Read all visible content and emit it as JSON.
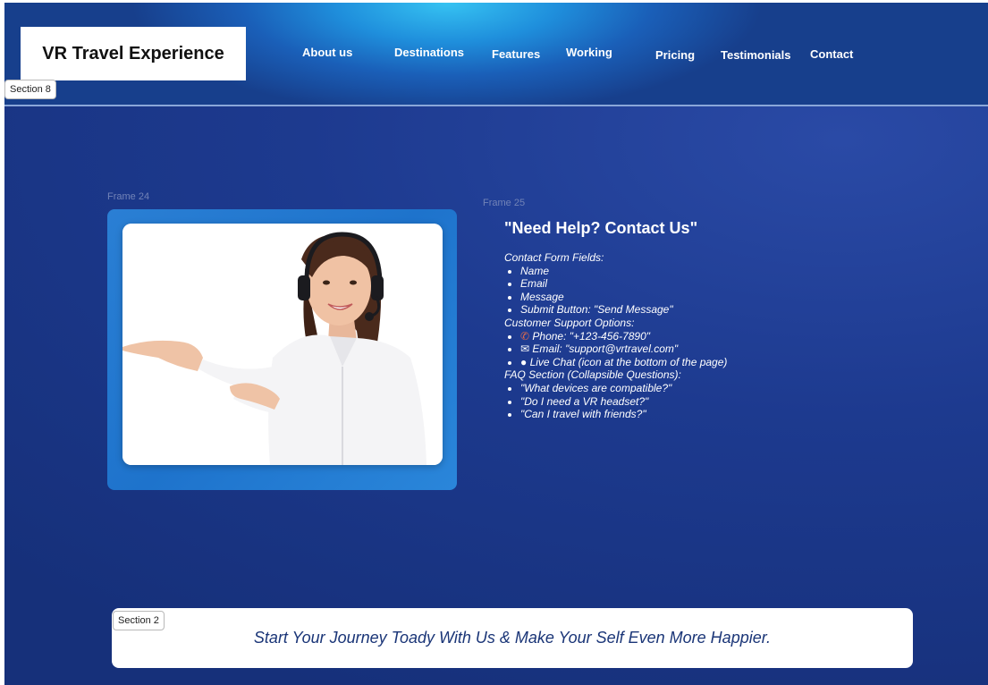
{
  "header": {
    "logo": "VR Travel Experience",
    "nav": [
      "About us",
      "Destinations",
      "Features",
      "Working",
      "Pricing",
      "Testimonials",
      "Contact"
    ]
  },
  "tags": {
    "section8": "Section 8",
    "section2": "Section 2"
  },
  "frames": {
    "frame24": "Frame 24",
    "frame25": "Frame 25"
  },
  "contact": {
    "title": "\"Need Help? Contact Us\"",
    "form_heading": "Contact Form Fields:",
    "form_fields": [
      "Name",
      "Email",
      "Message",
      "Submit Button: \"Send Message\""
    ],
    "support_heading": "Customer Support Options:",
    "support_options": [
      {
        "icon": "phone-icon",
        "text": "Phone: \"+123-456-7890\""
      },
      {
        "icon": "email-icon",
        "text": "Email: \"support@vrtravel.com\""
      },
      {
        "icon": "chat-icon",
        "text": "Live Chat (icon at the bottom of the page)"
      }
    ],
    "faq_heading": "FAQ Section (Collapsible Questions):",
    "faq": [
      "\"What devices are compatible?\"",
      "\"Do I need a VR headset?\"",
      "\"Can I travel with friends?\""
    ]
  },
  "cta": {
    "text": "Start Your Journey Toady With Us & Make Your Self Even More Happier."
  }
}
